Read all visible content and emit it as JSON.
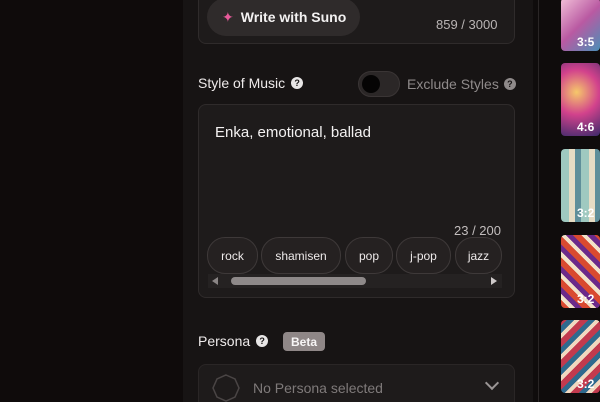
{
  "lyrics": {
    "write_button_label": "Write with Suno",
    "char_count": "859 / 3000"
  },
  "style": {
    "label": "Style of Music",
    "exclude_label": "Exclude Styles",
    "value": "Enka, emotional, ballad",
    "char_count": "23 / 200",
    "tags": [
      "rock",
      "shamisen",
      "pop",
      "j-pop",
      "jazz"
    ]
  },
  "persona": {
    "label": "Persona",
    "badge": "Beta",
    "placeholder": "No Persona selected"
  },
  "thumbnails": [
    {
      "duration": "3:5",
      "color": "#d9a3c9"
    },
    {
      "duration": "4:6",
      "color": "#c04a8f"
    },
    {
      "duration": "3:2",
      "color": "#7fb1a8"
    },
    {
      "duration": "3:2",
      "color": "#b8402f"
    },
    {
      "duration": "3:2",
      "color": "#9a3c46"
    }
  ]
}
